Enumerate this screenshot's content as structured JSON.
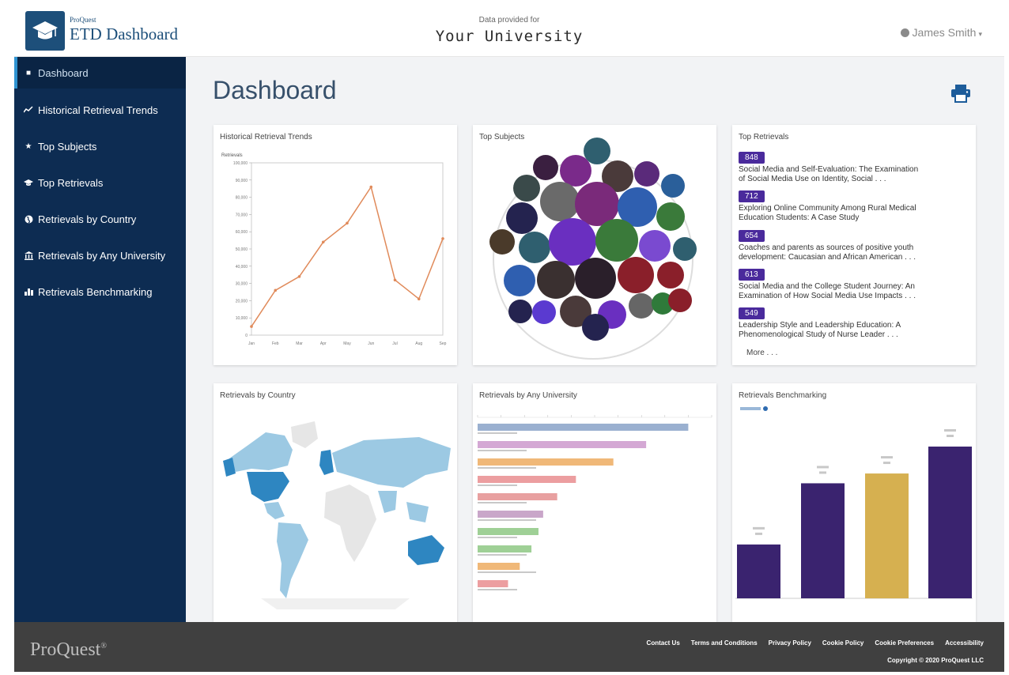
{
  "header": {
    "logo_small": "ProQuest",
    "logo_big": "ETD Dashboard",
    "provided_label": "Data provided for",
    "university": "Your University",
    "user_name": "James Smith"
  },
  "sidebar": {
    "items": [
      {
        "label": "Dashboard",
        "icon": "dashboard-icon"
      },
      {
        "label": "Historical Retrieval Trends",
        "icon": "trend-icon"
      },
      {
        "label": "Top Subjects",
        "icon": "star-icon"
      },
      {
        "label": "Top Retrievals",
        "icon": "graduation-cap-icon"
      },
      {
        "label": "Retrievals by Country",
        "icon": "globe-icon"
      },
      {
        "label": "Retrievals by Any University",
        "icon": "university-icon"
      },
      {
        "label": "Retrievals Benchmarking",
        "icon": "benchmark-icon"
      }
    ]
  },
  "main": {
    "title": "Dashboard"
  },
  "cards": {
    "trends_title": "Historical Retrieval Trends",
    "subjects_title": "Top Subjects",
    "retrievals_title": "Top Retrievals",
    "country_title": "Retrievals by Country",
    "university_title": "Retrievals by Any University",
    "benchmark_title": "Retrievals Benchmarking"
  },
  "top_retrievals": {
    "items": [
      {
        "count": "848",
        "line1": "Social Media and Self-Evaluation: The Examination",
        "line2": "of Social Media Use on Identity, Social . . ."
      },
      {
        "count": "712",
        "line1": "Exploring Online Community Among Rural Medical",
        "line2": "Education Students: A Case Study"
      },
      {
        "count": "654",
        "line1": "Coaches and parents as sources of positive youth",
        "line2": "development: Caucasian and African American . . ."
      },
      {
        "count": "613",
        "line1": "Social Media and the College Student Journey: An",
        "line2": "Examination of How Social Media Use Impacts . . ."
      },
      {
        "count": "549",
        "line1": "Leadership Style and Leadership Education: A",
        "line2": "Phenomenological Study of Nurse Leader . . ."
      }
    ],
    "more_label": "More . . ."
  },
  "chart_data": [
    {
      "type": "line",
      "title": "Historical Retrieval Trends",
      "ylabel": "Retrievals",
      "ylim": [
        0,
        100000
      ],
      "x": [
        "Jan",
        "Feb",
        "Mar",
        "Apr",
        "May",
        "Jun",
        "Jul",
        "Aug",
        "Sep"
      ],
      "values": [
        5000,
        26000,
        34000,
        54000,
        65000,
        86000,
        32000,
        21000,
        56000
      ],
      "color": "#e08a5a"
    },
    {
      "type": "bar",
      "title": "Retrievals by Any University",
      "orientation": "horizontal",
      "values": [
        4500,
        3600,
        2900,
        2100,
        1700,
        1400,
        1300,
        1150,
        900,
        650
      ],
      "colors": [
        "#9ab0d0",
        "#d4a8d4",
        "#f0b878",
        "#ec9ea0",
        "#e8a0a0",
        "#c9a6c9",
        "#9fd096",
        "#9fd096",
        "#f0b878",
        "#ec9ea0"
      ]
    },
    {
      "type": "bar",
      "title": "Retrievals Benchmarking",
      "values": [
        2.2,
        4.7,
        5.1,
        6.2
      ],
      "colors": [
        "#3a236f",
        "#3a236f",
        "#d6b050",
        "#3a236f"
      ]
    }
  ],
  "footer": {
    "brand": "ProQuest",
    "links": [
      "Contact Us",
      "Terms and Conditions",
      "Privacy Policy",
      "Cookie Policy",
      "Cookie Preferences",
      "Accessibility"
    ],
    "copyright": "Copyright © 2020 ProQuest LLC"
  }
}
